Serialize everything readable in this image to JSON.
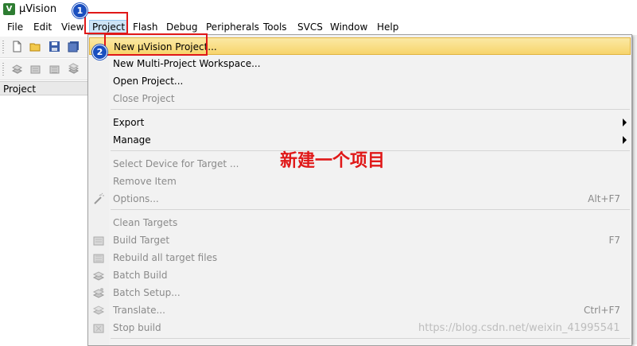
{
  "window": {
    "title": "µVision",
    "app_icon": "uvision-app-icon"
  },
  "menubar": {
    "items": [
      {
        "label": "File"
      },
      {
        "label": "Edit"
      },
      {
        "label": "View"
      },
      {
        "label": "Project"
      },
      {
        "label": "Flash"
      },
      {
        "label": "Debug"
      },
      {
        "label": "Peripherals"
      },
      {
        "label": "Tools"
      },
      {
        "label": "SVCS"
      },
      {
        "label": "Window"
      },
      {
        "label": "Help"
      }
    ],
    "active": "Project"
  },
  "panel": {
    "title": "Project"
  },
  "dropdown": {
    "items": [
      {
        "label": "New µVision Project...",
        "enabled": true,
        "highlighted": true
      },
      {
        "label": "New Multi-Project Workspace...",
        "enabled": true
      },
      {
        "label": "Open Project...",
        "enabled": true
      },
      {
        "label": "Close Project",
        "enabled": false
      },
      {
        "label": "Export",
        "enabled": true,
        "submenu": true
      },
      {
        "label": "Manage",
        "enabled": true,
        "submenu": true
      },
      {
        "label": "Select Device for Target ...",
        "enabled": false
      },
      {
        "label": "Remove Item",
        "enabled": false
      },
      {
        "label": "Options...",
        "enabled": false,
        "shortcut": "Alt+F7",
        "icon": "options-wand-icon"
      },
      {
        "label": "Clean Targets",
        "enabled": false
      },
      {
        "label": "Build Target",
        "enabled": false,
        "shortcut": "F7",
        "icon": "build-icon"
      },
      {
        "label": "Rebuild all target files",
        "enabled": false,
        "icon": "rebuild-icon"
      },
      {
        "label": "Batch Build",
        "enabled": false,
        "icon": "batch-build-icon"
      },
      {
        "label": "Batch Setup...",
        "enabled": false,
        "icon": "batch-setup-icon"
      },
      {
        "label": "Translate...",
        "enabled": false,
        "shortcut": "Ctrl+F7",
        "icon": "translate-icon"
      },
      {
        "label": "Stop build",
        "enabled": false,
        "icon": "stop-build-icon"
      }
    ]
  },
  "annotations": {
    "step1": "1",
    "step2": "2",
    "caption": "新建一个项目",
    "watermark": "https://blog.csdn.net/weixin_41995541"
  },
  "colors": {
    "highlight": "#f7d46c",
    "annotation_red": "#e01818",
    "badge_blue": "#1a4fbf"
  }
}
